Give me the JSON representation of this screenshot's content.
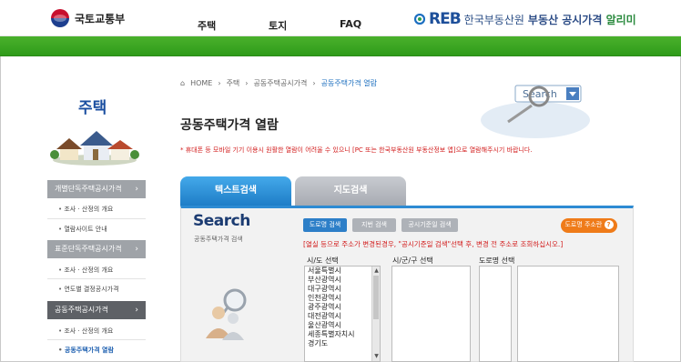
{
  "header": {
    "ministry": "국토교통부",
    "nav": [
      "주택",
      "토지",
      "FAQ"
    ],
    "reb_mark": "REB",
    "reb_name": "한국부동산원",
    "reb_service": "부동산 공시가격",
    "reb_alert": "알리미"
  },
  "sidebar": {
    "title": "주택",
    "groups": [
      {
        "label": "개별단독주택공시가격",
        "items": [
          "조사 · 산정의 개요",
          "열람사이트 안내"
        ]
      },
      {
        "label": "표준단독주택공시가격",
        "items": [
          "조사 · 산정의 개요",
          "연도별 결정공시가격"
        ]
      },
      {
        "label": "공동주택공시가격",
        "items": [
          "조사 · 산정의 개요",
          "공동주택가격 열람"
        ]
      }
    ]
  },
  "breadcrumb": [
    "HOME",
    "주택",
    "공동주택공시가격",
    "공동주택가격 열람"
  ],
  "page": {
    "title": "공동주택가격 열람",
    "notice": "* 휴대폰 등 모바일 기기 이용시 원활한 열람이 어려울 수 있으니 [PC 또는 한국부동산원 부동산정보 앱]으로 열람해주시기 바랍니다."
  },
  "tabs": [
    "텍스트검색",
    "지도검색"
  ],
  "search": {
    "heading": "Search",
    "subheading": "공동주택가격 검색",
    "buttons": [
      "도로명 검색",
      "지번 검색",
      "공시기준일 검색"
    ],
    "guide_button": "도로명 주소란",
    "helper": "[열실 등으로 주소가 변경된경우, \"공시기준일 검색\"선택 후, 변경 전 주소로 조회하십시오.]",
    "col_labels": [
      "시/도 선택",
      "시/군/구 선택",
      "도로명 선택"
    ],
    "sido_options": [
      "서울특별시",
      "부산광역시",
      "대구광역시",
      "인천광역시",
      "광주광역시",
      "대전광역시",
      "울산광역시",
      "세종특별자치시",
      "경기도"
    ],
    "banner_text": "Search"
  }
}
